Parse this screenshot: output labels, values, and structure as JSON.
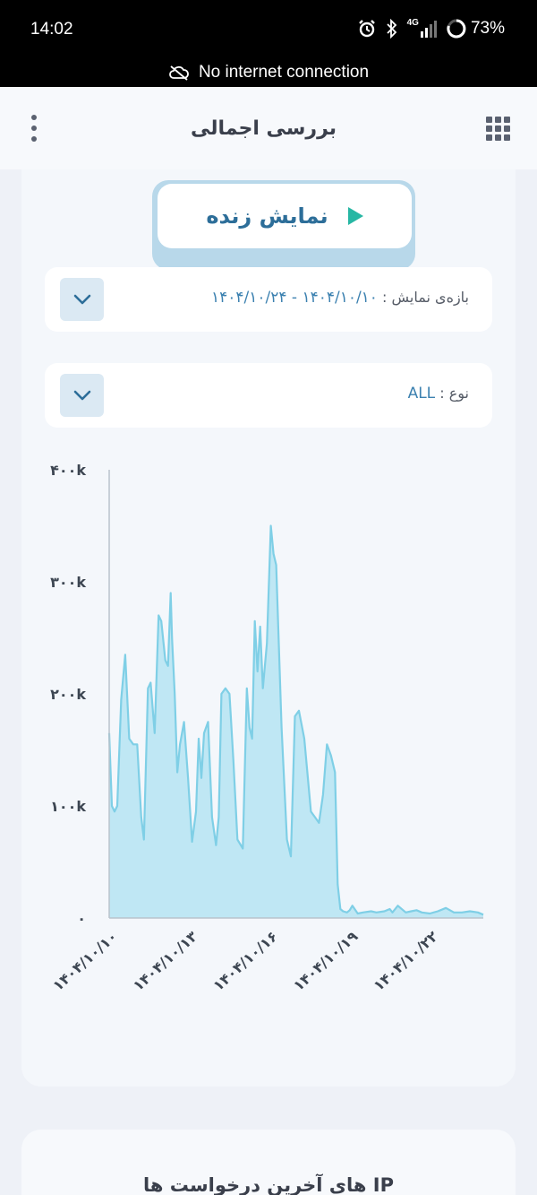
{
  "status_bar": {
    "time": "14:02",
    "network": "4G",
    "battery": "73%",
    "notice": "No internet connection"
  },
  "app_bar": {
    "title": "بررسی اجمالی"
  },
  "live_button": {
    "label": "نمایش زنده"
  },
  "range_filter": {
    "label": "بازه‌ی نمایش :",
    "value": "۱۴۰۴/۱۰/۱۰ - ۱۴۰۴/۱۰/۲۴"
  },
  "type_filter": {
    "label": "نوع :",
    "value": "ALL"
  },
  "chart_data": {
    "type": "area",
    "color": "#7fcfe6",
    "fill": "#bfe7f4",
    "ylim": [
      0,
      400000
    ],
    "y_ticks": [
      0,
      100000,
      200000,
      300000,
      400000
    ],
    "y_tick_labels": [
      "۰",
      "۱۰۰k",
      "۲۰۰k",
      "۳۰۰k",
      "۴۰۰k"
    ],
    "x_range": [
      0,
      14
    ],
    "x_ticks": [
      0,
      3,
      6,
      9,
      12
    ],
    "x_tick_labels": [
      "۱۴۰۴/۱۰/۱۰",
      "۱۴۰۴/۱۰/۱۳",
      "۱۴۰۴/۱۰/۱۶",
      "۱۴۰۴/۱۰/۱۹",
      "۱۴۰۴/۱۰/۲۲"
    ],
    "x": [
      0,
      0.1,
      0.2,
      0.3,
      0.45,
      0.6,
      0.75,
      0.9,
      1.05,
      1.2,
      1.3,
      1.45,
      1.55,
      1.7,
      1.85,
      1.95,
      2.1,
      2.2,
      2.3,
      2.35,
      2.45,
      2.55,
      2.65,
      2.8,
      2.95,
      3.1,
      3.25,
      3.35,
      3.45,
      3.55,
      3.7,
      3.85,
      4.0,
      4.1,
      4.2,
      4.35,
      4.5,
      4.65,
      4.8,
      5.0,
      5.15,
      5.25,
      5.35,
      5.45,
      5.55,
      5.65,
      5.75,
      5.9,
      6.05,
      6.15,
      6.25,
      6.45,
      6.65,
      6.8,
      6.95,
      7.1,
      7.3,
      7.55,
      7.7,
      7.85,
      8.0,
      8.15,
      8.3,
      8.45,
      8.55,
      8.65,
      8.75,
      8.9,
      9.0,
      9.1,
      9.3,
      9.5,
      9.8,
      10.0,
      10.3,
      10.5,
      10.6,
      10.8,
      11.1,
      11.3,
      11.5,
      11.7,
      12.0,
      12.3,
      12.6,
      12.9,
      13.2,
      13.5,
      13.8,
      14.0
    ],
    "values": [
      165000,
      100000,
      95000,
      100000,
      195000,
      235000,
      160000,
      155000,
      155000,
      90000,
      70000,
      205000,
      210000,
      165000,
      270000,
      265000,
      230000,
      225000,
      290000,
      250000,
      200000,
      130000,
      155000,
      175000,
      125000,
      68000,
      95000,
      160000,
      125000,
      165000,
      175000,
      90000,
      65000,
      90000,
      200000,
      205000,
      200000,
      140000,
      70000,
      62000,
      205000,
      170000,
      160000,
      265000,
      220000,
      260000,
      205000,
      245000,
      350000,
      325000,
      315000,
      170000,
      70000,
      55000,
      180000,
      185000,
      160000,
      95000,
      90000,
      85000,
      110000,
      155000,
      145000,
      130000,
      30000,
      8000,
      6000,
      5000,
      7000,
      11000,
      4000,
      5000,
      6000,
      5000,
      6000,
      8000,
      5000,
      11000,
      5000,
      6000,
      7000,
      5000,
      4000,
      6000,
      9000,
      5000,
      5000,
      6000,
      5000,
      3000
    ]
  },
  "last_section": {
    "title": "IP های آخرین درخواست ها"
  }
}
